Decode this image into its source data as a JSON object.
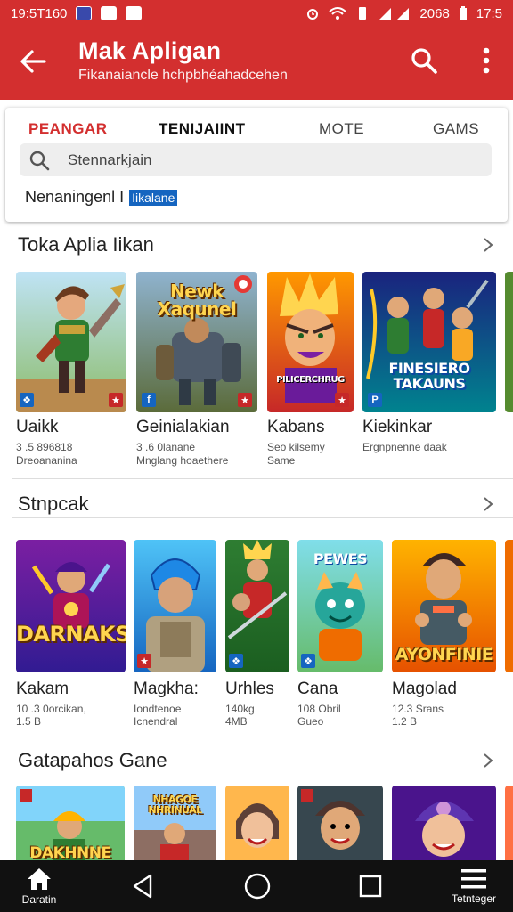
{
  "status_bar": {
    "time": "19:5T160",
    "right_text": "2068",
    "battery": "17:5"
  },
  "app_bar": {
    "title": "Mak Apligan",
    "subtitle": "Fikanaiancle hchpbhéahadcehen"
  },
  "tabs": [
    {
      "label": "PEANGAR",
      "state": "active"
    },
    {
      "label": "TENIJAIINT",
      "state": "bold"
    },
    {
      "label": "MOTE",
      "state": "normal"
    },
    {
      "label": "GAMS",
      "state": "normal"
    }
  ],
  "search": {
    "value": "Stennarkjain"
  },
  "filter": {
    "label": "Nenaningenl I",
    "tag": "Iikalane"
  },
  "sections": [
    {
      "title": "Toka Aplia Iikan",
      "items": [
        {
          "name": "Uaikk",
          "meta1": "3 .5 896818",
          "meta2": "Dreoananina",
          "art": "warrior"
        },
        {
          "name": "Geinialakian",
          "meta1": "3 .6 0lanane",
          "meta2": "Mnglang hoaethere",
          "art": "robot",
          "thumb_text": "Newk Xaqunel"
        },
        {
          "name": "Kabans",
          "meta1": "Seo kilsemy",
          "meta2": "Same",
          "art": "hero",
          "thumb_text": "PILICERCHRUG"
        },
        {
          "name": "Kiekinkar",
          "meta1": "Ergnpnenne daak",
          "meta2": "",
          "art": "battle",
          "thumb_text": "FINESIERO TAKAUNS"
        }
      ]
    },
    {
      "title": "Stnpcak",
      "items": [
        {
          "name": "Kakam",
          "meta1": "10 .3 0orcikan,",
          "meta2": "1.5 B",
          "art": "mage",
          "thumb_text": "DARNAKS"
        },
        {
          "name": "Magkha:",
          "meta1": "Iondtenoe",
          "meta2": "Icnendral",
          "art": "knight"
        },
        {
          "name": "Urhles",
          "meta1": "140kg",
          "meta2": "4MB",
          "art": "soldier"
        },
        {
          "name": "Cana",
          "meta1": "108 Obril",
          "meta2": "Gueo",
          "art": "dragon",
          "thumb_text": "PEWES"
        },
        {
          "name": "Magolad",
          "meta1": "12.3 Srans",
          "meta2": "1.2 B",
          "art": "rogue",
          "thumb_text": "AYONFINIE"
        }
      ]
    },
    {
      "title": "Gatapahos Gane",
      "items": [
        {
          "art": "elf",
          "thumb_text": "DAKHNNE"
        },
        {
          "art": "armor",
          "thumb_text": "NHAGOE NHRINUAL"
        },
        {
          "art": "girl"
        },
        {
          "art": "boy"
        },
        {
          "art": "hood"
        }
      ]
    }
  ],
  "nav": {
    "home_label": "Daratin",
    "menu_label": "Tetnteger"
  },
  "colors": {
    "accent": "#d32f2f",
    "tag": "#1565c0",
    "nav": "#111111"
  }
}
